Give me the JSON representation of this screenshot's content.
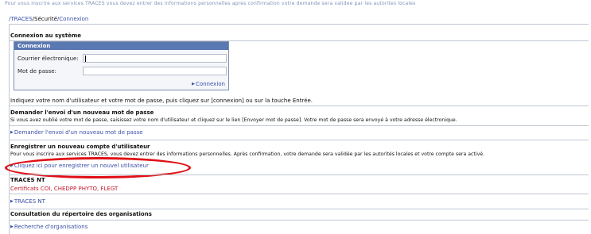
{
  "top_line": "Pour vous inscrire aux services TRACES vous devez entrer des informations personnelles apres confirmation votre demande sera validee par les autorites locales",
  "breadcrumb": {
    "part1": "/TRACES",
    "part2": "/Sécurité",
    "part3": "/Connexion"
  },
  "login": {
    "section_title": "Connexion au système",
    "box_title": "Connexion",
    "email_label": "Courrier électronique:",
    "password_label": "Mot de passe:",
    "submit_label": "Connexion",
    "instructions": "Indiquez votre nom d'utilisateur et votre mot de passe, puis cliquez sur [connexion] ou sur la touche Entrée."
  },
  "reset": {
    "title": "Demander l'envoi d'un nouveau mot de passe",
    "text": "Si vous avez oublié votre mot de passe, saisissez votre nom d'utilisateur et cliquez sur le lien [Envoyer mot de passe]. Votre mot de passe sera envoyé à votre adresse électronique.",
    "link": "Demander l'envoi d'un nouveau mot de passe"
  },
  "register": {
    "title": "Enregistrer un nouveau compte d'utilisateur",
    "text": "Pour vous inscrire aux services TRACES, vous devez entrer des informations personnelles. Après confirmation, votre demande sera validée par les autorités locales et votre compte sera activé.",
    "link": "Cliquez ici pour enregistrer un nouvel utilisateur"
  },
  "traces_nt": {
    "title": "TRACES NT",
    "subtitle": "Certificats COI, CHEDPP PHYTO, FLEGT",
    "link": "TRACES NT"
  },
  "directory": {
    "title": "Consultation du répertoire des organisations",
    "link": "Recherche d'organisations"
  },
  "colors": {
    "link": "#3a4fa8",
    "header_blue": "#5a78b1",
    "highlight_oval": "#e01016",
    "red_text": "#c0162c"
  }
}
